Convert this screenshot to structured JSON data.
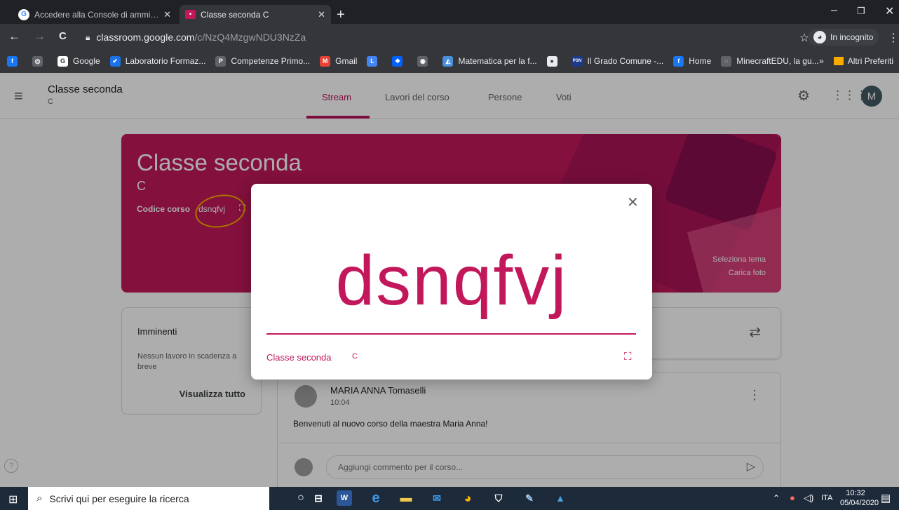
{
  "browser": {
    "tabs": [
      {
        "title": "Accedere alla Console di amminis",
        "icon": "google-g-icon"
      },
      {
        "title": "Classe seconda C",
        "icon": "classroom-icon"
      }
    ],
    "new_tab": "+",
    "url_domain": "classroom.google.com",
    "url_path": "/c/NzQ4MzgwNDU3NzZa",
    "incognito_label": "In incognito",
    "bookmarks": [
      {
        "label": "",
        "icon": "facebook-icon",
        "glyph": "f",
        "color": "#1877f2"
      },
      {
        "label": "",
        "icon": "bookmark-icon",
        "glyph": "◎",
        "color": "#5f6368"
      },
      {
        "label": "Google",
        "icon": "google-g-icon",
        "glyph": "G",
        "color": "#ffffff"
      },
      {
        "label": "Laboratorio Formaz...",
        "icon": "check-icon",
        "glyph": "✔",
        "color": "#1a73e8"
      },
      {
        "label": "Competenze Primo...",
        "icon": "p-icon",
        "glyph": "P",
        "color": "#5f6368"
      },
      {
        "label": "Gmail",
        "icon": "gmail-icon",
        "glyph": "M",
        "color": "#ea4335"
      },
      {
        "label": "",
        "icon": "l-icon",
        "glyph": "L",
        "color": "#4285f4"
      },
      {
        "label": "",
        "icon": "dropbox-icon",
        "glyph": "❖",
        "color": "#0061ff"
      },
      {
        "label": "",
        "icon": "camera-icon",
        "glyph": "◉",
        "color": "#5f6368"
      },
      {
        "label": "Matematica per la f...",
        "icon": "geogebra-icon",
        "glyph": "◭",
        "color": "#4a90d9"
      },
      {
        "label": "",
        "icon": "circle-icon",
        "glyph": "●",
        "color": "#e8eaed"
      },
      {
        "label": "Il Grado Comune -...",
        "icon": "psn-icon",
        "glyph": "PSN",
        "color": "#1a3a8a"
      },
      {
        "label": "Home",
        "icon": "facebook-icon",
        "glyph": "f",
        "color": "#1877f2"
      },
      {
        "label": "MinecraftEDU, la gu...",
        "icon": "minecraft-icon",
        "glyph": "◌",
        "color": "#5f6368"
      }
    ],
    "bookmarks_more": "»",
    "other_bookmarks": "Altri Preferiti"
  },
  "app": {
    "course_title": "Classe seconda",
    "course_section": "C",
    "tabs": [
      "Stream",
      "Lavori del corso",
      "Persone",
      "Voti"
    ],
    "avatar_letter": "M"
  },
  "banner": {
    "title": "Classe seconda",
    "section": "C",
    "code_label": "Codice corso",
    "code": "dsnqfvj",
    "select_theme": "Seleziona tema",
    "upload_photo": "Carica foto"
  },
  "upcoming": {
    "title": "Imminenti",
    "empty": "Nessun lavoro in scadenza a breve",
    "view_all": "Visualizza tutto"
  },
  "post": {
    "author": "MARIA ANNA Tomaselli",
    "time": "10:04",
    "body": "Benvenuti al nuovo corso della maestra Maria Anna!",
    "comment_placeholder": "Aggiungi commento per il corso..."
  },
  "modal": {
    "code": "dsnqfvj",
    "class_name": "Classe seconda",
    "section": "C"
  },
  "taskbar": {
    "search_placeholder": "Scrivi qui per eseguire la ricerca",
    "language": "ITA",
    "time": "10:32",
    "date": "05/04/2020"
  }
}
